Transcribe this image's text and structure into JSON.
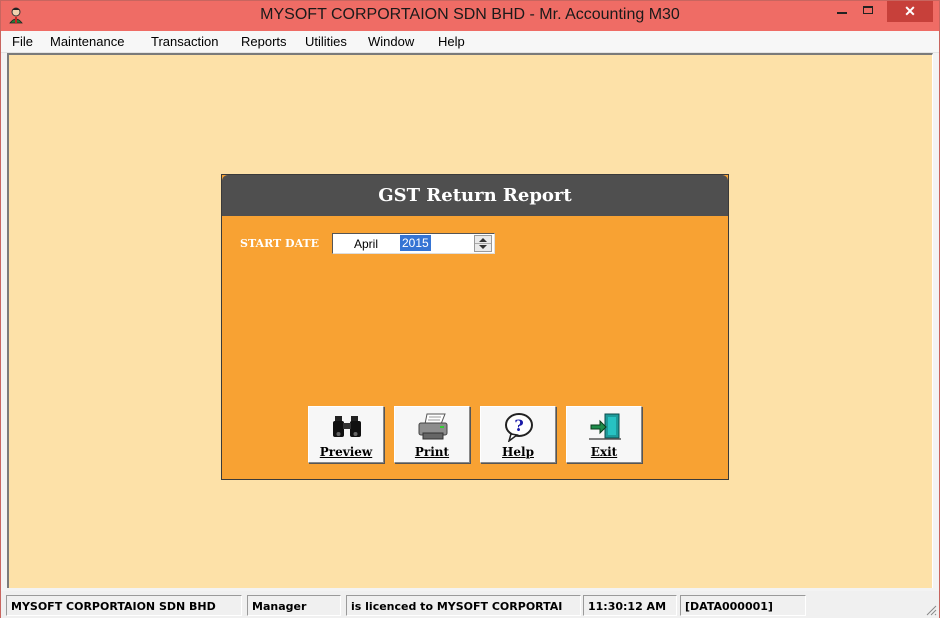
{
  "window": {
    "title": "MYSOFT CORPORTAION SDN BHD - Mr. Accounting M30",
    "close_glyph": "✕",
    "icons": [
      "app-logo-icon",
      "minimize-icon",
      "maximize-icon",
      "close-icon"
    ]
  },
  "menu": {
    "items": [
      "File",
      "Maintenance",
      "Transaction",
      "Reports",
      "Utilities",
      "Window",
      "Help"
    ]
  },
  "dialog": {
    "title": "GST Return Report",
    "start_date_label": "START DATE",
    "month": "April",
    "year": "2015",
    "buttons": [
      {
        "label": "Preview",
        "icon": "binoculars-icon"
      },
      {
        "label": "Print",
        "icon": "printer-icon"
      },
      {
        "label": "Help",
        "icon": "help-icon"
      },
      {
        "label": "Exit",
        "icon": "exit-door-icon"
      }
    ]
  },
  "status": {
    "company": "MYSOFT CORPORTAION SDN BHD",
    "user": "Manager",
    "licence": "is licenced to MYSOFT CORPORTAI",
    "time": "11:30:12 AM",
    "data_code": "[DATA000001]"
  },
  "colors": {
    "titlebar": "#ef6c65",
    "workspace": "#fde1a8",
    "dialog_body": "#f8a233",
    "dialog_header": "#4f4f4f",
    "selection": "#3574d4"
  }
}
